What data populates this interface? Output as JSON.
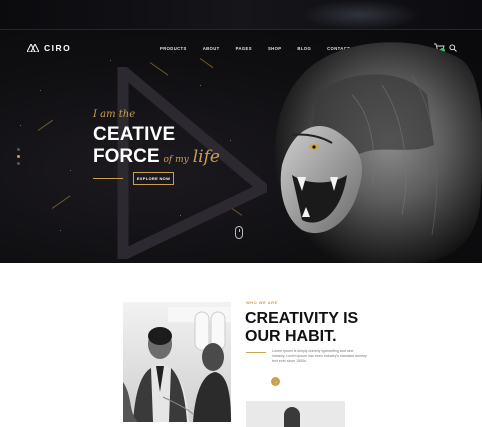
{
  "header": {
    "brand": "CIRO",
    "nav": [
      "PRODUCTS",
      "ABOUT",
      "PAGES",
      "SHOP",
      "BLOG",
      "CONTACT"
    ],
    "icons": [
      "cart-icon",
      "search-icon"
    ],
    "cart_badge_color": "#3cc46a"
  },
  "hero": {
    "tagline": "I am the",
    "headline_line1": "CEATIVE",
    "headline_line2": "FORCE",
    "headline_script_small": "of my",
    "headline_script": "life",
    "cta": "EXPLORE NOW",
    "slide_count": 3,
    "active_slide": 1,
    "accent_color": "#c9a14e"
  },
  "about": {
    "eyebrow": "WHO WE ARE",
    "title": "CREATIVITY IS OUR HABIT.",
    "body": "Lorem ipsum is simply dummy typesetting and nine industry. Lorem ipsum has been industry's standard dummy text ever since 1500s."
  }
}
